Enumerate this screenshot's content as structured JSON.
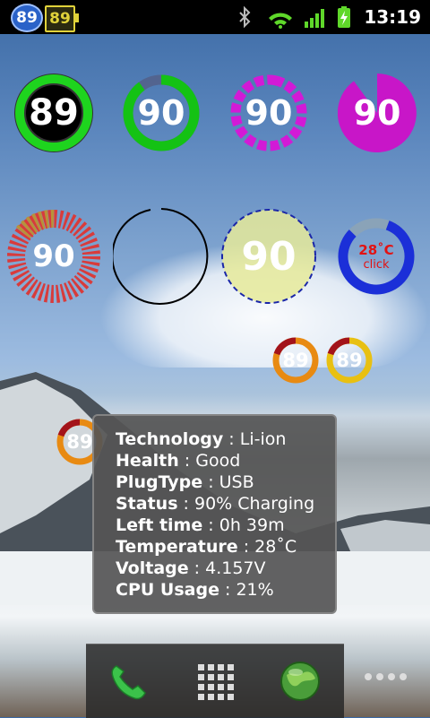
{
  "status_bar": {
    "battery_circle": "89",
    "battery_box": "89",
    "time": "13:19",
    "icons": [
      "bluetooth-icon",
      "wifi-icon",
      "signal-icon",
      "battery-charging-icon"
    ]
  },
  "widgets": [
    {
      "id": "w1",
      "value": "89",
      "percent": 89
    },
    {
      "id": "w2",
      "value": "90",
      "percent": 90
    },
    {
      "id": "w3",
      "value": "90",
      "percent": 90
    },
    {
      "id": "w4",
      "value": "90",
      "percent": 90
    },
    {
      "id": "w5",
      "value": "90",
      "percent": 90
    },
    {
      "id": "w6",
      "value": "",
      "percent": 0
    },
    {
      "id": "w7",
      "value": "90",
      "percent": 90
    },
    {
      "id": "w8",
      "value": "28˚C",
      "sub": "click",
      "percent": 80
    },
    {
      "id": "w9",
      "value": "89",
      "percent": 89
    },
    {
      "id": "w10",
      "value": "89",
      "percent": 89
    },
    {
      "id": "w11",
      "value": "89",
      "percent": 89
    }
  ],
  "popup": {
    "rows": [
      {
        "key": "Technology",
        "val": "Li-ion"
      },
      {
        "key": "Health",
        "val": "Good"
      },
      {
        "key": "PlugType",
        "val": "USB"
      },
      {
        "key": "Status",
        "val": "90% Charging"
      },
      {
        "key": "Left time",
        "val": "0h 39m"
      },
      {
        "key": "Temperature",
        "val": "28˚C"
      },
      {
        "key": "Voltage",
        "val": "4.157V"
      },
      {
        "key": "CPU Usage",
        "val": "21%"
      }
    ]
  },
  "dock": {
    "items": [
      "phone-icon",
      "app-drawer-icon",
      "browser-globe-icon"
    ]
  },
  "colors": {
    "green": "#1ed41e",
    "magenta": "#d21ad6",
    "red": "#d83b3b",
    "blue": "#1b2fd8",
    "orange": "#e88a12"
  }
}
